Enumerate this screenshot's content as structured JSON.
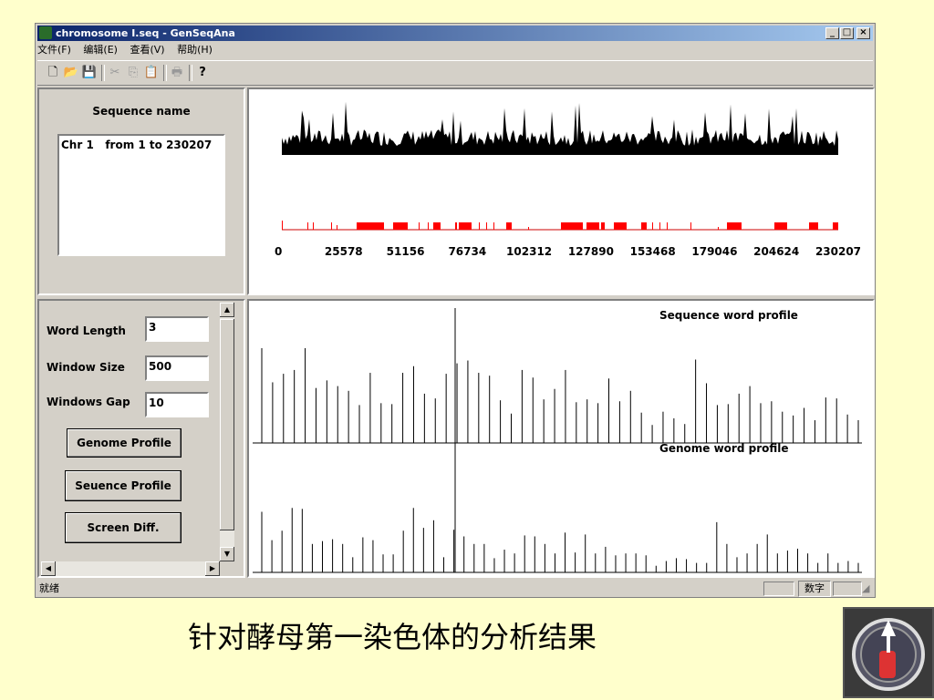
{
  "window": {
    "title": "chromosome I.seq - GenSeqAna",
    "min": "_",
    "max": "□",
    "close": "×"
  },
  "menu": [
    "文件(F)",
    "编辑(E)",
    "查看(V)",
    "帮助(H)"
  ],
  "toolbar": {
    "icons": [
      "new-icon",
      "open-icon",
      "save-icon",
      "cut-icon",
      "copy-icon",
      "paste-icon",
      "print-icon",
      "help-icon"
    ],
    "help_glyph": "?"
  },
  "seqpanel": {
    "header": "Sequence name",
    "items": [
      "Chr 1   from 1 to 230207"
    ]
  },
  "controls": {
    "word_length_label": "Word Length",
    "word_length": "3",
    "window_size_label": "Window Size",
    "window_size": "500",
    "windows_gap_label": "Windows Gap",
    "windows_gap": "10",
    "genome_btn": "Genome Profile",
    "sequence_btn": "Seuence Profile",
    "screen_btn": "Screen  Diff."
  },
  "genome_view": {
    "ticks": [
      "0",
      "25578",
      "51156",
      "76734",
      "102312",
      "127890",
      "153468",
      "179046",
      "204624",
      "230207"
    ]
  },
  "profiles": {
    "seq_title": "Sequence word profile",
    "genome_title": "Genome word profile"
  },
  "status": {
    "left": "就绪",
    "num": "数字"
  },
  "caption": "针对酵母第一染色体的分析结果",
  "chart_data": [
    {
      "type": "bar",
      "title": "Sequence word profile",
      "values": [
        100,
        64,
        73,
        77,
        100,
        58,
        66,
        60,
        55,
        40,
        74,
        42,
        41,
        74,
        81,
        52,
        47,
        73,
        84,
        87,
        74,
        71,
        45,
        31,
        77,
        69,
        46,
        57,
        77,
        43,
        46,
        42,
        68,
        44,
        55,
        32,
        19,
        33,
        26,
        20,
        88,
        63,
        40,
        41,
        52,
        60,
        42,
        44,
        33,
        29,
        37,
        24,
        48,
        47,
        30,
        24
      ]
    },
    {
      "type": "bar",
      "title": "Genome word profile",
      "values": [
        64,
        34,
        44,
        68,
        67,
        30,
        33,
        35,
        30,
        16,
        37,
        34,
        19,
        19,
        44,
        68,
        47,
        55,
        16,
        45,
        38,
        30,
        30,
        15,
        24,
        20,
        39,
        38,
        30,
        20,
        42,
        21,
        40,
        20,
        27,
        18,
        20,
        20,
        18,
        7,
        12,
        15,
        14,
        10,
        10,
        53,
        30,
        16,
        20,
        30,
        40,
        20,
        23,
        25,
        20,
        10,
        20,
        10,
        12,
        10
      ]
    }
  ]
}
